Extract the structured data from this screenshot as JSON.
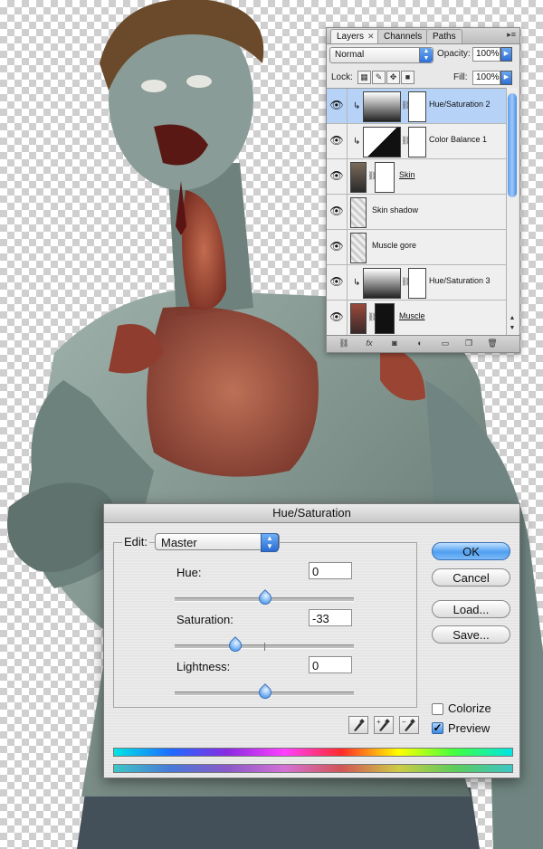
{
  "layers_panel": {
    "tabs": [
      {
        "label": "Layers",
        "close": "✕",
        "active": true
      },
      {
        "label": "Channels",
        "active": false
      },
      {
        "label": "Paths",
        "active": false
      }
    ],
    "menu_icon": "▸≡",
    "blend_mode": "Normal",
    "opacity_label": "Opacity:",
    "opacity_value": "100%",
    "lock_label": "Lock:",
    "fill_label": "Fill:",
    "fill_value": "100%",
    "layers": [
      {
        "name": "Hue/Saturation 2",
        "kind": "adjustment",
        "clipped": true,
        "selected": true,
        "underline": false
      },
      {
        "name": "Color Balance 1",
        "kind": "balance",
        "clipped": true,
        "selected": false,
        "underline": false
      },
      {
        "name": "Skin",
        "kind": "masked",
        "clipped": false,
        "selected": false,
        "underline": true
      },
      {
        "name": "Skin shadow",
        "kind": "pixel",
        "clipped": false,
        "selected": false,
        "underline": false
      },
      {
        "name": "Muscle gore",
        "kind": "pixel",
        "clipped": false,
        "selected": false,
        "underline": false
      },
      {
        "name": "Hue/Saturation 3",
        "kind": "adjustment",
        "clipped": true,
        "selected": false,
        "underline": false
      },
      {
        "name": "Muscle",
        "kind": "masked",
        "clipped": false,
        "selected": false,
        "underline": true
      }
    ]
  },
  "hue_saturation_dialog": {
    "title": "Hue/Saturation",
    "edit_label": "Edit:",
    "edit_value": "Master",
    "hue_label": "Hue:",
    "hue_value": "0",
    "saturation_label": "Saturation:",
    "saturation_value": "-33",
    "lightness_label": "Lightness:",
    "lightness_value": "0",
    "slider_range": [
      -100,
      100
    ],
    "ok_label": "OK",
    "cancel_label": "Cancel",
    "load_label": "Load...",
    "save_label": "Save...",
    "colorize_label": "Colorize",
    "colorize_checked": false,
    "preview_label": "Preview",
    "preview_checked": true
  },
  "colors": {
    "accent_blue": "#4f9ff0",
    "selection": "#b6d3f7",
    "skin": "#7f918b",
    "gore": "#9c4a3a"
  }
}
